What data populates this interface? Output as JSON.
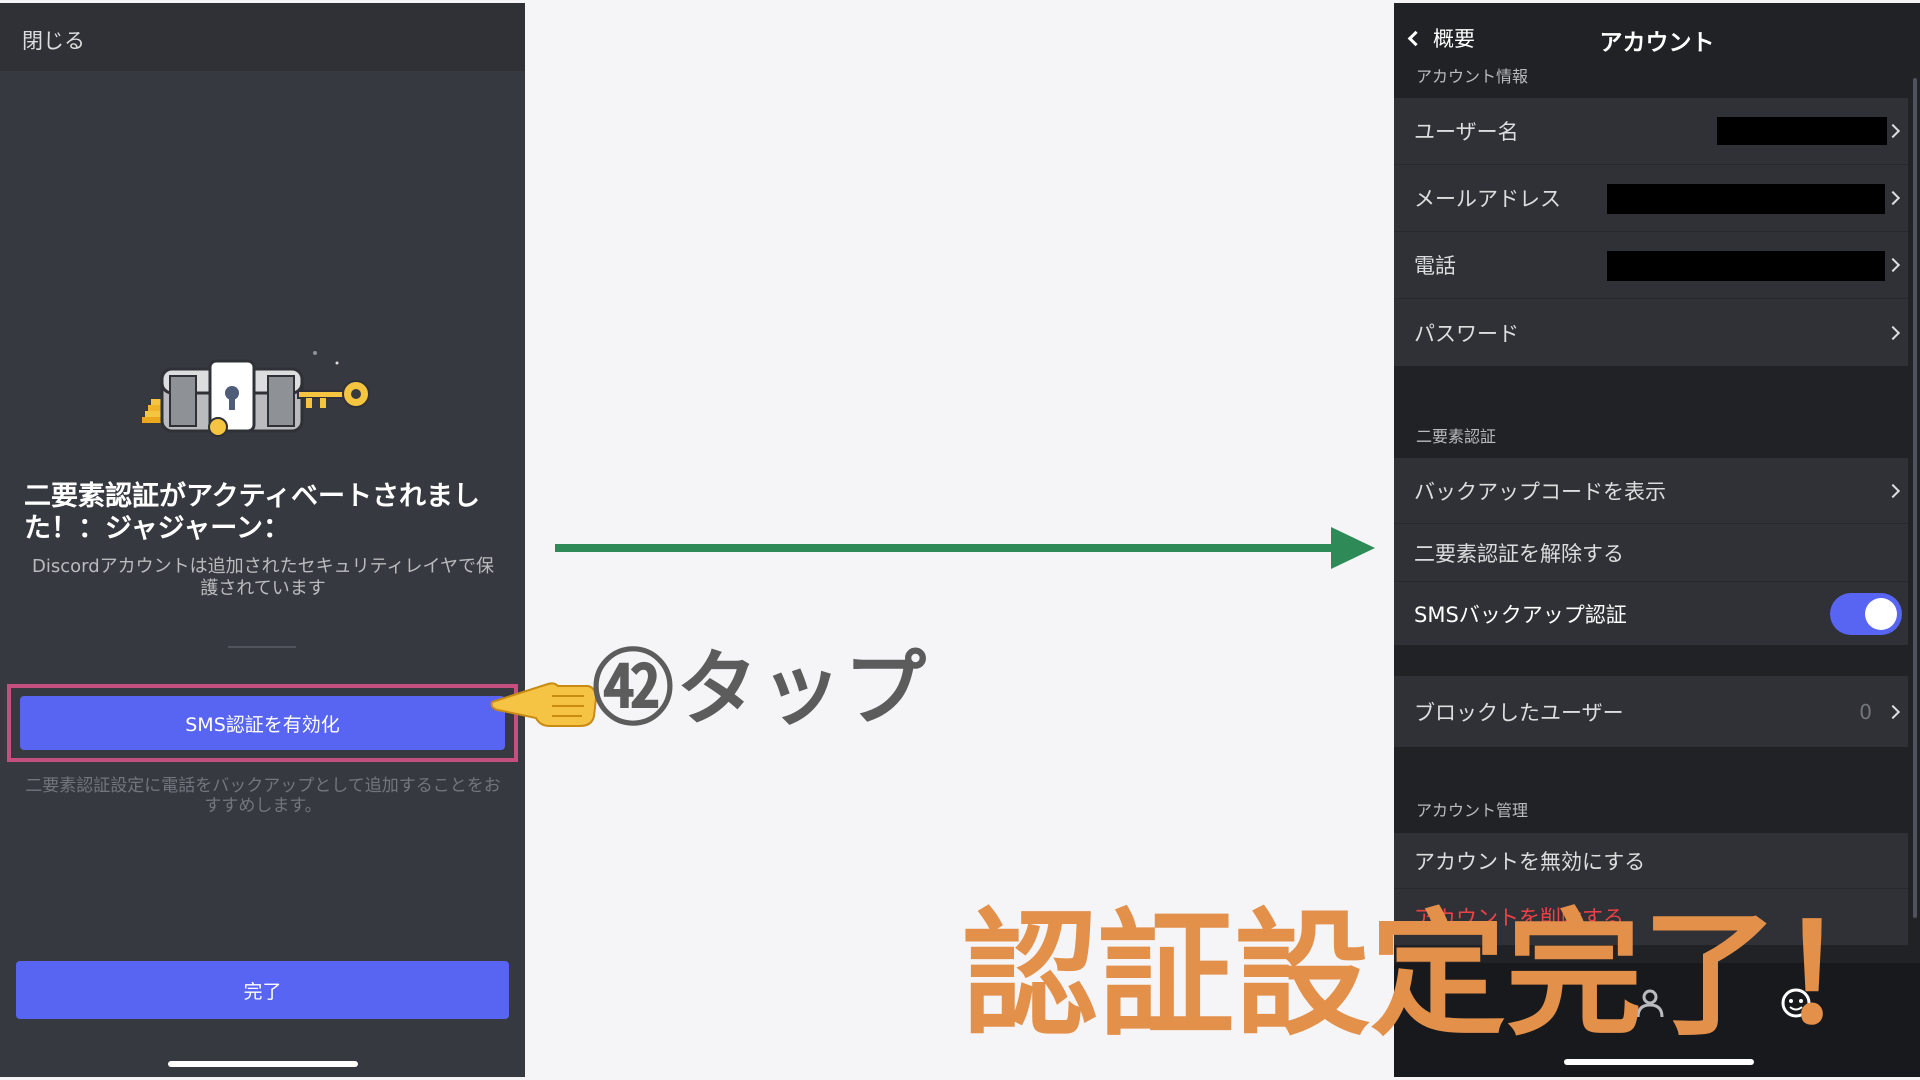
{
  "left_screen": {
    "close_label": "閉じる",
    "title": "二要素認証がアクティベートされました！：ジャジャーン：",
    "description": "Discordアカウントは追加されたセキュリティレイヤで保護されています",
    "sms_button_label": "SMS認証を有効化",
    "recommendation": "二要素認証設定に電話をバックアップとして追加することをおすすめします。",
    "done_label": "完了"
  },
  "annotation": {
    "step_label": "㊷タップ",
    "completion_label": "認証設定完了！"
  },
  "right_screen": {
    "back_label": "概要",
    "title": "アカウント",
    "account_info_section": "アカウント情報",
    "account_rows": [
      {
        "label": "ユーザー名",
        "value_redacted": true
      },
      {
        "label": "メールアドレス",
        "value_redacted": true
      },
      {
        "label": "電話",
        "value_redacted": true
      },
      {
        "label": "パスワード"
      }
    ],
    "mfa_section": "二要素認証",
    "mfa_rows": [
      {
        "label": "バックアップコードを表示"
      },
      {
        "label": "二要素認証を解除する"
      },
      {
        "label": "SMSバックアップ認証",
        "toggle_on": true
      }
    ],
    "blocked_users_label": "ブロックしたユーザー",
    "blocked_users_count": "0",
    "account_management_section": "アカウント管理",
    "disable_account_label": "アカウントを無効にする",
    "delete_account_label": "アカウントを削除する"
  },
  "colors": {
    "blurple": "#5865f2",
    "highlight_border": "#c4507f",
    "arrow_green": "#2e8b57",
    "danger_red": "#ed4245",
    "completion_orange": "#e3904a"
  }
}
